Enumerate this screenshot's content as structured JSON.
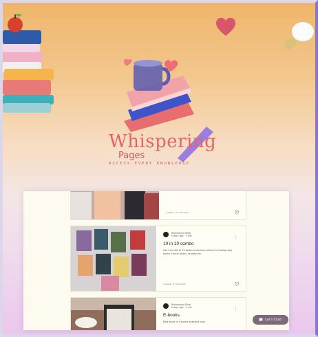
{
  "brand": {
    "title": "Whispering",
    "subtitle": "Pages",
    "tagline": "ACCESS EVERY KNOWLEDGE"
  },
  "posts": [
    {
      "stats": "0 views · 0 comments",
      "title": "",
      "author": "",
      "date": "",
      "description": ""
    },
    {
      "author": "Wuhanonya Wing",
      "date": "2 days ago · 1 min",
      "title": "10 in 10 combo",
      "description": "Get a bundle of 10 books of various authors including copy books. Horror books, fantasy etc.",
      "stats": "0 views · 0 comments"
    },
    {
      "author": "Wuhanonya Wing",
      "date": "2 days ago · 1 min",
      "title": "E-books",
      "description": "New stock of e-books available now",
      "stats": ""
    }
  ],
  "chat": {
    "label": "Let's Chat!"
  },
  "colors": {
    "brand": "#e0666a",
    "panel": "#fdfbef",
    "chat": "#7c6a7a"
  }
}
